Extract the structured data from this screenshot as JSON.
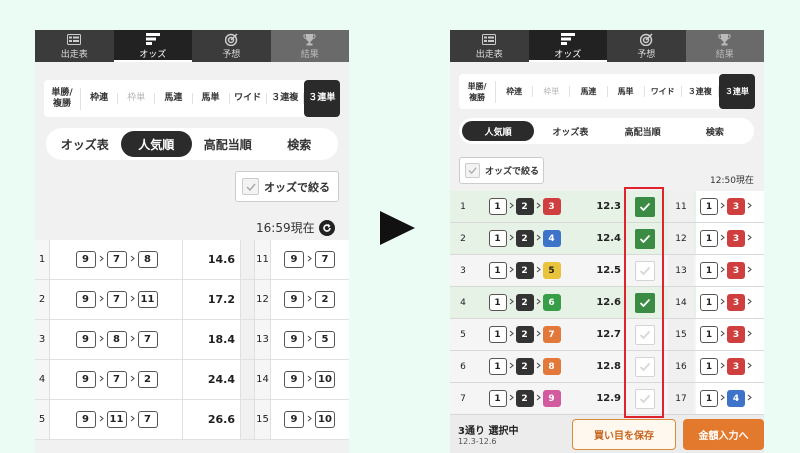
{
  "nav": [
    "出走表",
    "オッズ",
    "予想",
    "結果"
  ],
  "bet_types": [
    {
      "label": "単勝/\n複勝",
      "state": "normal"
    },
    {
      "label": "枠連",
      "state": "normal"
    },
    {
      "label": "枠単",
      "state": "disabled"
    },
    {
      "label": "馬連",
      "state": "normal"
    },
    {
      "label": "馬単",
      "state": "normal"
    },
    {
      "label": "ワイド",
      "state": "normal"
    },
    {
      "label": "３連複",
      "state": "normal"
    },
    {
      "label": "３連単",
      "state": "active"
    }
  ],
  "left": {
    "views": [
      "オッズ表",
      "人気順",
      "高配当順",
      "検索"
    ],
    "active_view": 1,
    "filter_label": "オッズで絞る",
    "time": "16:59現在",
    "rows": [
      {
        "rank": "1",
        "horses": [
          "9",
          "7",
          "8"
        ],
        "odds": "14.6",
        "rank2": "11",
        "horses2": [
          "9",
          "7"
        ]
      },
      {
        "rank": "2",
        "horses": [
          "9",
          "7",
          "11"
        ],
        "odds": "17.2",
        "rank2": "12",
        "horses2": [
          "9",
          "2"
        ]
      },
      {
        "rank": "3",
        "horses": [
          "9",
          "8",
          "7"
        ],
        "odds": "18.4",
        "rank2": "13",
        "horses2": [
          "9",
          "5"
        ]
      },
      {
        "rank": "4",
        "horses": [
          "9",
          "7",
          "2"
        ],
        "odds": "24.4",
        "rank2": "14",
        "horses2": [
          "9",
          "10"
        ]
      },
      {
        "rank": "5",
        "horses": [
          "9",
          "11",
          "7"
        ],
        "odds": "26.6",
        "rank2": "15",
        "horses2": [
          "9",
          "10"
        ]
      }
    ]
  },
  "right": {
    "views": [
      "人気順",
      "オッズ表",
      "高配当順",
      "検索"
    ],
    "active_view": 0,
    "filter_label": "オッズで絞る",
    "time": "12:50現在",
    "rows": [
      {
        "rank": "1",
        "horses": [
          "1",
          "2",
          "3"
        ],
        "odds": "12.3",
        "checked": true,
        "rank2": "11",
        "horses2": [
          "1",
          "3"
        ]
      },
      {
        "rank": "2",
        "horses": [
          "1",
          "2",
          "4"
        ],
        "odds": "12.4",
        "checked": true,
        "rank2": "12",
        "horses2": [
          "1",
          "3"
        ]
      },
      {
        "rank": "3",
        "horses": [
          "1",
          "2",
          "5"
        ],
        "odds": "12.5",
        "checked": false,
        "rank2": "13",
        "horses2": [
          "1",
          "3"
        ]
      },
      {
        "rank": "4",
        "horses": [
          "1",
          "2",
          "6"
        ],
        "odds": "12.6",
        "checked": true,
        "rank2": "14",
        "horses2": [
          "1",
          "3"
        ]
      },
      {
        "rank": "5",
        "horses": [
          "1",
          "2",
          "7"
        ],
        "odds": "12.7",
        "checked": false,
        "rank2": "15",
        "horses2": [
          "1",
          "3"
        ]
      },
      {
        "rank": "6",
        "horses": [
          "1",
          "2",
          "8"
        ],
        "odds": "12.8",
        "checked": false,
        "rank2": "16",
        "horses2": [
          "1",
          "3"
        ]
      },
      {
        "rank": "7",
        "horses": [
          "1",
          "2",
          "9"
        ],
        "odds": "12.9",
        "checked": false,
        "rank2": "17",
        "horses2": [
          "1",
          "4"
        ]
      }
    ],
    "footer": {
      "count": "3通り 選択中",
      "range": "12.3-12.6",
      "save_label": "買い目を保存",
      "amount_label": "金額入力へ"
    }
  },
  "colors": {
    "accent_orange": "#e2792c",
    "check_green": "#3a8b44",
    "highlight_red": "#e0242d",
    "horse_colors": {
      "1": "",
      "2": "#333333",
      "3": "#cf3f3f",
      "4": "#3d73c9",
      "5": "#e9c33c",
      "6": "#379e47",
      "7": "#e2793a",
      "8": "#e2793a",
      "9": "#d35a9e"
    }
  },
  "icons": [
    "list-icon",
    "odds-icon",
    "target-icon",
    "trophy-icon",
    "refresh-icon",
    "check-icon"
  ]
}
